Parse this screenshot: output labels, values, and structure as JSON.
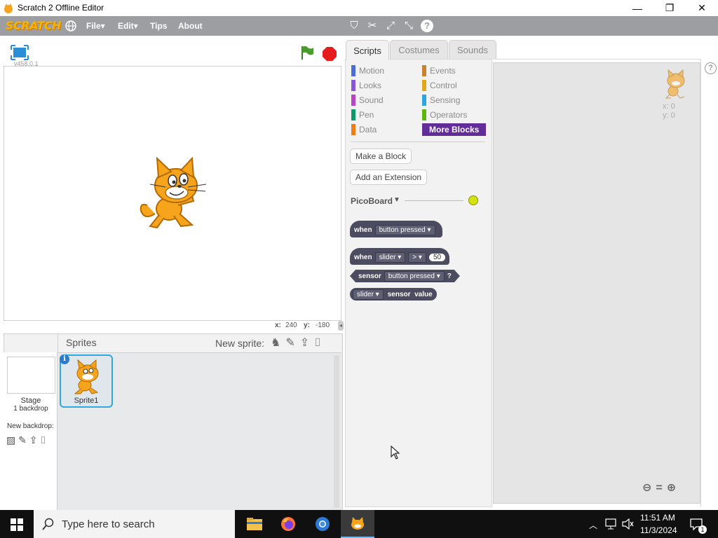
{
  "window": {
    "title": "Scratch 2 Offline Editor",
    "controls": [
      "—",
      "❐",
      "✕"
    ]
  },
  "menubar": {
    "logo": "SCRATCH",
    "items": [
      "File▾",
      "Edit▾",
      "Tips",
      "About"
    ]
  },
  "stage": {
    "version": "v458.0.1",
    "x_label": "x:",
    "x_value": "240",
    "y_label": "y:",
    "y_value": "-180"
  },
  "tabs": [
    "Scripts",
    "Costumes",
    "Sounds"
  ],
  "categories_left": [
    {
      "label": "Motion",
      "color": "#4a6cd4"
    },
    {
      "label": "Looks",
      "color": "#8a55d7"
    },
    {
      "label": "Sound",
      "color": "#bb42c3"
    },
    {
      "label": "Pen",
      "color": "#0e9a6c"
    },
    {
      "label": "Data",
      "color": "#ee7d16"
    }
  ],
  "categories_right": [
    {
      "label": "Events",
      "color": "#c88330"
    },
    {
      "label": "Control",
      "color": "#e1a91a"
    },
    {
      "label": "Sensing",
      "color": "#2ca5e2"
    },
    {
      "label": "Operators",
      "color": "#5cb712"
    },
    {
      "label": "More Blocks",
      "color": "#632d99"
    }
  ],
  "palette": {
    "make_block": "Make a Block",
    "add_extension": "Add an Extension",
    "extension_name": "PicoBoard",
    "blocks": {
      "b1_when": "when",
      "b1_dd": "button pressed",
      "b2_when": "when",
      "b2_dd": "slider",
      "b2_op": ">",
      "b2_num": "50",
      "b3_sensor": "sensor",
      "b3_dd": "button pressed",
      "b3_q": "?",
      "b4_dd": "slider",
      "b4_text": "sensor  value"
    }
  },
  "script_area": {
    "x": "x: 0",
    "y": "y: 0"
  },
  "sprites": {
    "header": "Sprites",
    "new_sprite": "New sprite:",
    "stage_label": "Stage",
    "backdrop_count": "1 backdrop",
    "new_backdrop": "New backdrop:",
    "sprite1": "Sprite1"
  },
  "taskbar": {
    "search_placeholder": "Type here to search",
    "time": "11:51 AM",
    "date": "11/3/2024",
    "notifications": "1"
  }
}
